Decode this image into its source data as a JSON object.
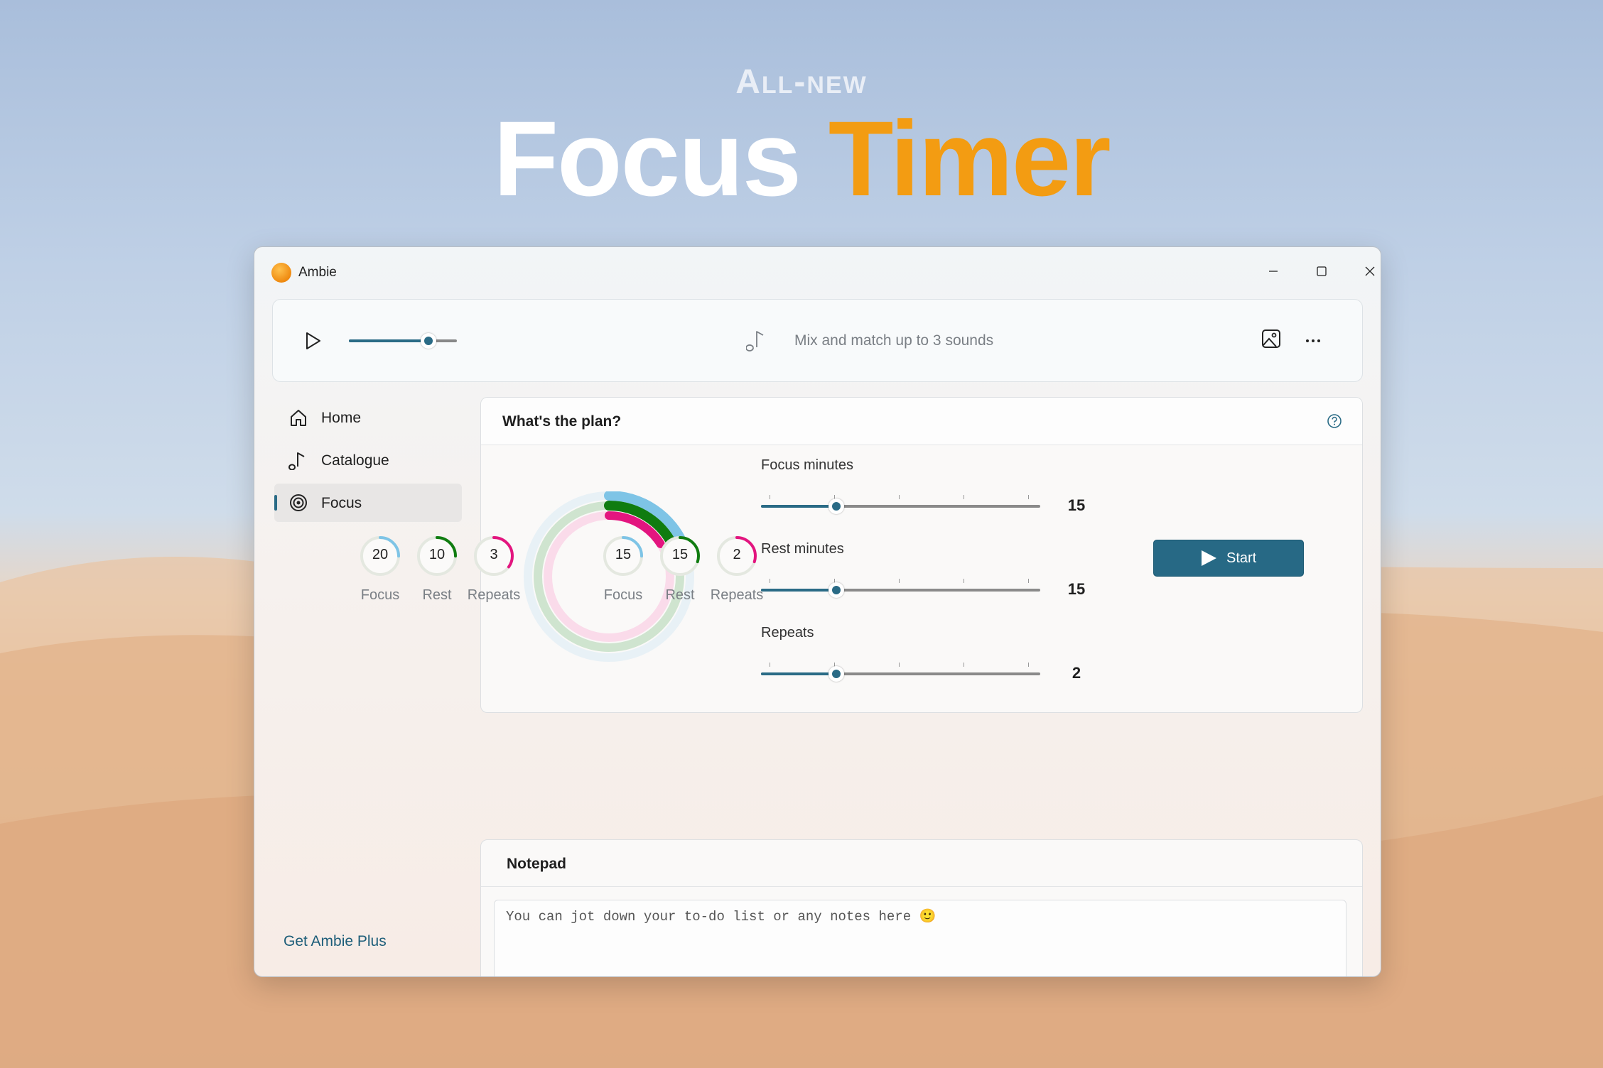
{
  "hero": {
    "kicker": "All-new",
    "title_part1": "Focus",
    "title_part2": "Timer"
  },
  "window": {
    "app_name": "Ambie"
  },
  "player": {
    "volume_percent": 74,
    "prompt": "Mix and match up to 3 sounds"
  },
  "nav": {
    "items": [
      {
        "label": "Home",
        "icon": "home-icon",
        "active": false
      },
      {
        "label": "Catalogue",
        "icon": "music-note-icon",
        "active": false
      },
      {
        "label": "Focus",
        "icon": "target-icon",
        "active": true
      }
    ],
    "get_plus": "Get Ambie Plus"
  },
  "plan": {
    "title": "What's the plan?",
    "sliders": [
      {
        "label": "Focus minutes",
        "value": "15",
        "fraction": 0.27
      },
      {
        "label": "Rest minutes",
        "value": "15",
        "fraction": 0.27
      },
      {
        "label": "Repeats",
        "value": "2",
        "fraction": 0.27
      }
    ],
    "start_label": "Start",
    "ring_progress": {
      "focus": 0.19,
      "rest": 0.19,
      "repeat": 0.16
    }
  },
  "presets": [
    [
      {
        "value": "20",
        "label": "Focus",
        "color": "#7ec4e6",
        "fraction": 0.25
      },
      {
        "value": "10",
        "label": "Rest",
        "color": "#107c10",
        "fraction": 0.25
      },
      {
        "value": "3",
        "label": "Repeats",
        "color": "#e3157f",
        "fraction": 0.35
      }
    ],
    [
      {
        "value": "15",
        "label": "Focus",
        "color": "#7ec4e6",
        "fraction": 0.25
      },
      {
        "value": "15",
        "label": "Rest",
        "color": "#107c10",
        "fraction": 0.3
      },
      {
        "value": "2",
        "label": "Repeats",
        "color": "#e3157f",
        "fraction": 0.3
      }
    ]
  ],
  "notepad": {
    "title": "Notepad",
    "placeholder": "You can jot down your to-do list or any notes here 🙂"
  },
  "colors": {
    "accent": "#2a6b86",
    "focus": "#7ec4e6",
    "rest": "#107c10",
    "repeat": "#e3157f",
    "title_orange": "#f39c12"
  }
}
